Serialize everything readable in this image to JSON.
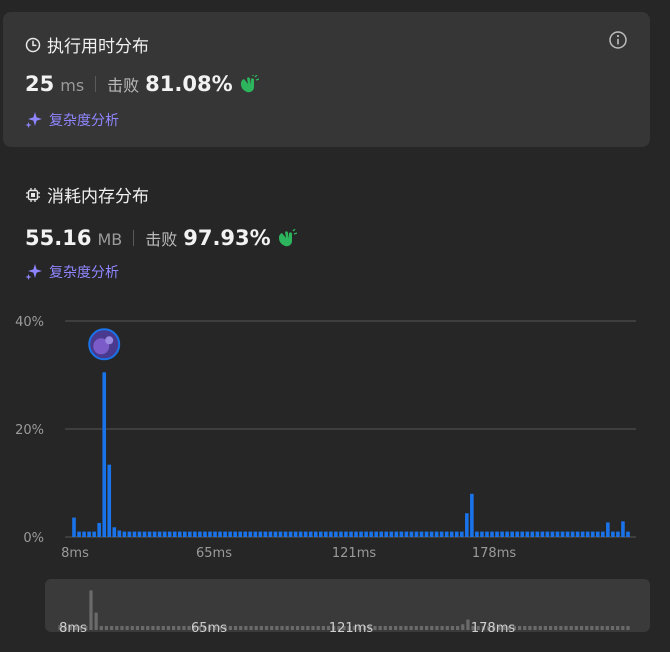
{
  "runtime": {
    "title": "执行用时分布",
    "value": "25",
    "unit": "ms",
    "beat_label": "击败",
    "beat_percent": "81.08%",
    "analyze_label": "复杂度分析",
    "icon": "clock-icon",
    "info_icon": "info-icon"
  },
  "memory": {
    "title": "消耗内存分布",
    "value": "55.16",
    "unit": "MB",
    "beat_label": "击败",
    "beat_percent": "97.93%",
    "analyze_label": "复杂度分析",
    "icon": "chip-icon"
  },
  "colors": {
    "accent_blue": "#1a73e8",
    "clap_green": "#2db55d",
    "ai_purple": "#8f86ff",
    "card_bg": "#363636",
    "page_bg": "#262626"
  },
  "chart_data": {
    "type": "bar",
    "ylabel": "",
    "xlabel": "",
    "ylim": [
      0,
      40
    ],
    "y_ticks": [
      "40%",
      "20%",
      "0%"
    ],
    "x_ticks": [
      "8ms",
      "65ms",
      "121ms",
      "178ms"
    ],
    "grid": true,
    "highlight_bar_index": 6,
    "values": [
      3.6,
      1,
      1,
      1,
      1,
      2.6,
      30.5,
      13.4,
      1.8,
      1.2,
      1,
      1,
      1,
      1,
      1,
      1,
      1,
      1,
      1,
      1,
      1,
      1,
      1,
      1,
      1,
      1,
      1,
      1,
      1,
      1,
      1,
      1,
      1,
      1,
      1,
      1,
      1,
      1,
      1,
      1,
      1,
      1,
      1,
      1,
      1,
      1,
      1,
      1,
      1,
      1,
      1,
      1,
      1,
      1,
      1,
      1,
      1,
      1,
      1,
      1,
      1,
      1,
      1,
      1,
      1,
      1,
      1,
      1,
      1,
      1,
      1,
      1,
      1,
      1,
      1,
      1,
      1,
      1,
      4.4,
      8,
      1,
      1,
      1,
      1,
      1,
      1,
      1,
      1,
      1,
      1,
      1,
      1,
      1,
      1,
      1,
      1,
      1,
      1,
      1,
      1,
      1,
      1,
      1,
      1,
      1,
      1,
      2.7,
      1,
      1,
      2.9,
      1
    ],
    "minimap": {
      "x_ticks": [
        "8ms",
        "65ms",
        "121ms",
        "178ms"
      ]
    }
  }
}
